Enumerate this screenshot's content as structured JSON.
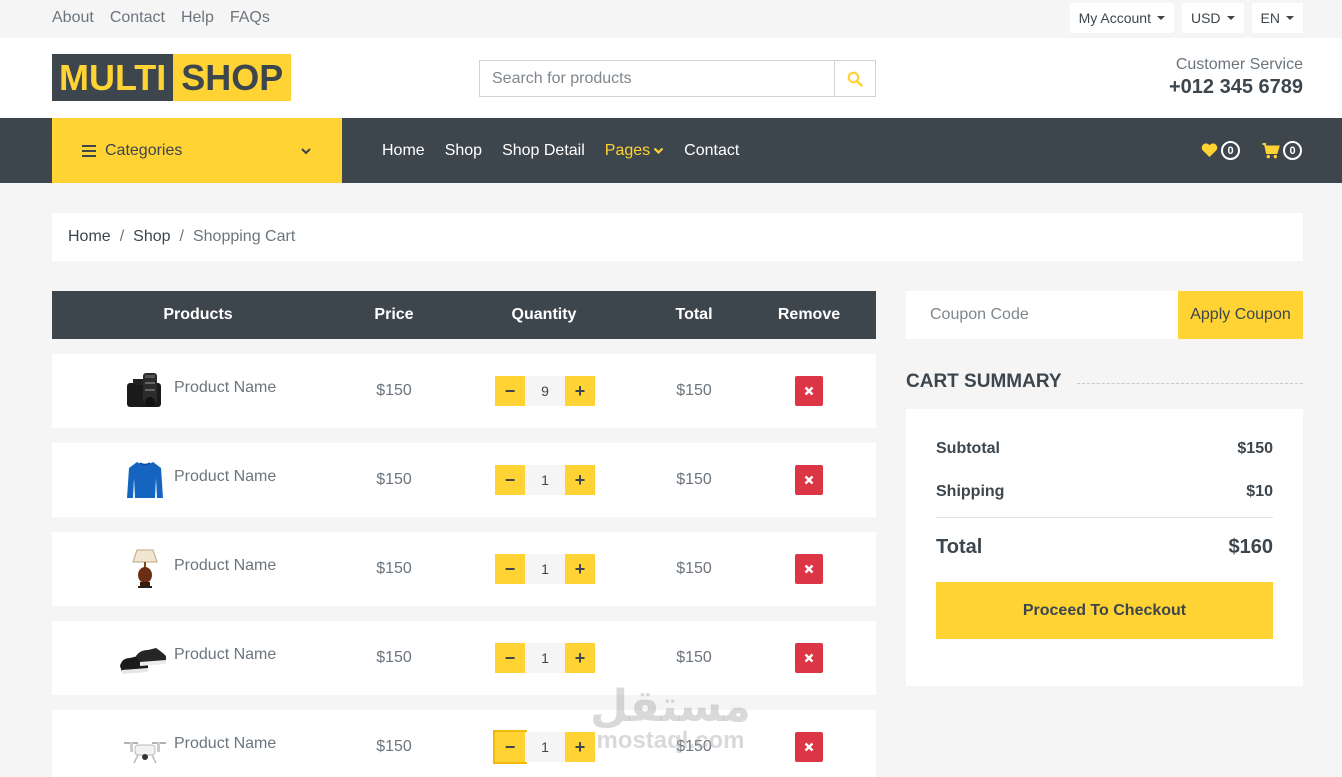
{
  "topbar": {
    "links": [
      "About",
      "Contact",
      "Help",
      "FAQs"
    ],
    "account_label": "My Account",
    "currency_label": "USD",
    "language_label": "EN"
  },
  "header": {
    "logo_part1": "MULTI",
    "logo_part2": "SHOP",
    "search_placeholder": "Search for products",
    "service_label": "Customer Service",
    "service_phone": "+012 345 6789"
  },
  "nav": {
    "categories_label": "Categories",
    "links": [
      "Home",
      "Shop",
      "Shop Detail",
      "Pages",
      "Contact"
    ],
    "wishlist_count": "0",
    "cart_count": "0"
  },
  "breadcrumb": {
    "home": "Home",
    "shop": "Shop",
    "current": "Shopping Cart"
  },
  "cart": {
    "headers": [
      "Products",
      "Price",
      "Quantity",
      "Total",
      "Remove"
    ],
    "items": [
      {
        "name": "Product Name",
        "price": "$150",
        "qty": "9",
        "total": "$150",
        "image": "camera"
      },
      {
        "name": "Product Name",
        "price": "$150",
        "qty": "1",
        "total": "$150",
        "image": "sweater"
      },
      {
        "name": "Product Name",
        "price": "$150",
        "qty": "1",
        "total": "$150",
        "image": "lamp"
      },
      {
        "name": "Product Name",
        "price": "$150",
        "qty": "1",
        "total": "$150",
        "image": "shoes"
      },
      {
        "name": "Product Name",
        "price": "$150",
        "qty": "1",
        "total": "$150",
        "image": "drone"
      }
    ]
  },
  "coupon": {
    "placeholder": "Coupon Code",
    "button_label": "Apply Coupon"
  },
  "summary": {
    "title": "CART SUMMARY",
    "subtotal_label": "Subtotal",
    "subtotal_value": "$150",
    "shipping_label": "Shipping",
    "shipping_value": "$10",
    "total_label": "Total",
    "total_value": "$160",
    "checkout_label": "Proceed To Checkout"
  },
  "watermark": {
    "arabic": "مستقل",
    "latin": "mostaql.com"
  },
  "colors": {
    "primary": "#ffd333",
    "dark": "#3d464d",
    "danger": "#dc3545"
  }
}
